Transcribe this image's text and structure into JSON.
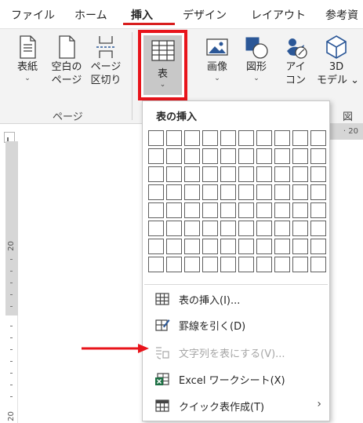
{
  "tabs": [
    {
      "label": "ファイル"
    },
    {
      "label": "ホーム"
    },
    {
      "label": "挿入"
    },
    {
      "label": "デザイン"
    },
    {
      "label": "レイアウト"
    },
    {
      "label": "参考資"
    }
  ],
  "ribbon": {
    "pages_group": {
      "label": "ページ",
      "buttons": [
        {
          "line1": "表紙",
          "line2": "⌄"
        },
        {
          "line1": "空白の",
          "line2": "ページ"
        },
        {
          "line1": "ページ",
          "line2": "区切り"
        }
      ]
    },
    "table_button": {
      "line1": "表",
      "line2": "⌄"
    },
    "illustrations_group": {
      "label": "図",
      "buttons": [
        {
          "line1": "画像",
          "line2": "⌄"
        },
        {
          "line1": "図形",
          "line2": "⌄"
        },
        {
          "line1": "アイ",
          "line2": "コン"
        },
        {
          "line1": "3D",
          "line2": "モデル ⌄"
        }
      ]
    }
  },
  "rulers": {
    "horizontal_label": "· 20",
    "vertical_labels": [
      "20",
      "20"
    ]
  },
  "dropdown": {
    "title": "表の挿入",
    "grid": {
      "columns": 10,
      "rows": 8
    },
    "items": [
      {
        "label": "表の挿入(I)...",
        "icon": "insert-table-icon",
        "disabled": false
      },
      {
        "label": "罫線を引く(D)",
        "icon": "draw-table-icon",
        "disabled": false
      },
      {
        "label": "文字列を表にする(V)...",
        "icon": "convert-text-icon",
        "disabled": true
      },
      {
        "label": "Excel ワークシート(X)",
        "icon": "excel-icon",
        "disabled": false
      },
      {
        "label": "クイック表作成(T)",
        "icon": "quick-table-icon",
        "disabled": false,
        "submenu": "›"
      }
    ]
  },
  "colors": {
    "accent_red": "#e8141b",
    "ribbon_bg": "#f3f3f3",
    "excel_green": "#1d7044",
    "icon_blue": "#2b5797"
  }
}
